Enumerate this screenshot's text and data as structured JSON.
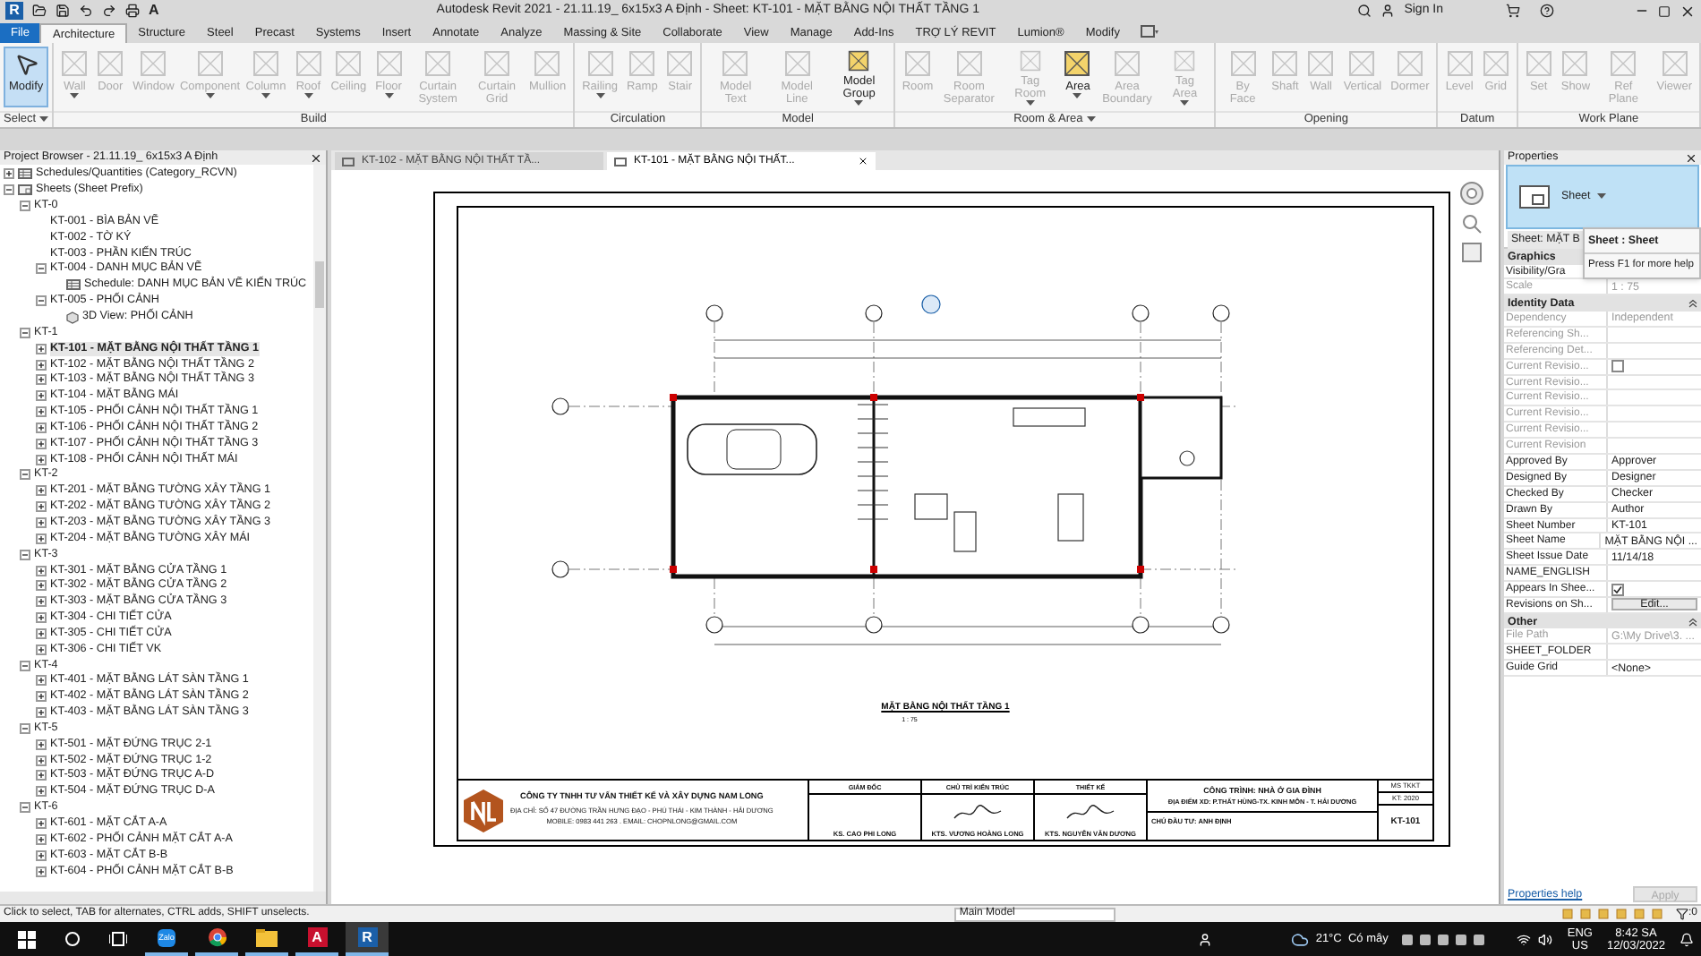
{
  "title_bar": {
    "app_logo": "R",
    "qat_text_tool": "A",
    "title": "Autodesk Revit 2021 - 21.11.19_ 6x15x3 A Định - Sheet: KT-101 - MẶT BẰNG NỘI THẤT TẦNG 1",
    "sign_in": "Sign In"
  },
  "ribbon_tabs": [
    {
      "label": "File",
      "kind": "file",
      "selected": false
    },
    {
      "label": "Architecture",
      "kind": "tab",
      "selected": true
    },
    {
      "label": "Structure",
      "kind": "tab",
      "selected": false
    },
    {
      "label": "Steel",
      "kind": "tab",
      "selected": false
    },
    {
      "label": "Precast",
      "kind": "tab",
      "selected": false
    },
    {
      "label": "Systems",
      "kind": "tab",
      "selected": false
    },
    {
      "label": "Insert",
      "kind": "tab",
      "selected": false
    },
    {
      "label": "Annotate",
      "kind": "tab",
      "selected": false
    },
    {
      "label": "Analyze",
      "kind": "tab",
      "selected": false
    },
    {
      "label": "Massing & Site",
      "kind": "tab",
      "selected": false
    },
    {
      "label": "Collaborate",
      "kind": "tab",
      "selected": false
    },
    {
      "label": "View",
      "kind": "tab",
      "selected": false
    },
    {
      "label": "Manage",
      "kind": "tab",
      "selected": false
    },
    {
      "label": "Add-Ins",
      "kind": "tab",
      "selected": false
    },
    {
      "label": "TRỢ LÝ REVIT",
      "kind": "tab",
      "selected": false
    },
    {
      "label": "Lumion®",
      "kind": "tab",
      "selected": false
    },
    {
      "label": "Modify",
      "kind": "tab",
      "selected": false
    }
  ],
  "ribbon_groups": [
    {
      "label": "Select",
      "dropdown": true,
      "tools": [
        {
          "label": "Modify",
          "disabled": false,
          "selected": true
        }
      ]
    },
    {
      "label": "Build",
      "tools": [
        {
          "label": "Wall",
          "disabled": true,
          "dropdown": true
        },
        {
          "label": "Door",
          "disabled": true
        },
        {
          "label": "Window",
          "disabled": true
        },
        {
          "label": "Component",
          "disabled": true,
          "dropdown": true
        },
        {
          "label": "Column",
          "disabled": true,
          "dropdown": true
        },
        {
          "label": "Roof",
          "disabled": true,
          "dropdown": true
        },
        {
          "label": "Ceiling",
          "disabled": true
        },
        {
          "label": "Floor",
          "disabled": true,
          "dropdown": true
        },
        {
          "label": "Curtain System",
          "disabled": true
        },
        {
          "label": "Curtain Grid",
          "disabled": true
        },
        {
          "label": "Mullion",
          "disabled": true
        }
      ]
    },
    {
      "label": "Circulation",
      "tools": [
        {
          "label": "Railing",
          "disabled": true,
          "dropdown": true
        },
        {
          "label": "Ramp",
          "disabled": true
        },
        {
          "label": "Stair",
          "disabled": true
        }
      ]
    },
    {
      "label": "Model",
      "tools": [
        {
          "label": "Model Text",
          "disabled": true
        },
        {
          "label": "Model Line",
          "disabled": true
        },
        {
          "label": "Model Group",
          "disabled": false,
          "dropdown": true
        }
      ]
    },
    {
      "label": "Room & Area",
      "dropdown": true,
      "tools": [
        {
          "label": "Room",
          "disabled": true
        },
        {
          "label": "Room Separator",
          "disabled": true
        },
        {
          "label": "Tag Room",
          "disabled": true,
          "dropdown": true
        },
        {
          "label": "Area",
          "disabled": false,
          "dropdown": true
        },
        {
          "label": "Area Boundary",
          "disabled": true
        },
        {
          "label": "Tag Area",
          "disabled": true,
          "dropdown": true
        }
      ]
    },
    {
      "label": "Opening",
      "tools": [
        {
          "label": "By Face",
          "disabled": true
        },
        {
          "label": "Shaft",
          "disabled": true
        },
        {
          "label": "Wall",
          "disabled": true
        },
        {
          "label": "Vertical",
          "disabled": true
        },
        {
          "label": "Dormer",
          "disabled": true
        }
      ]
    },
    {
      "label": "Datum",
      "tools": [
        {
          "label": "Level",
          "disabled": true
        },
        {
          "label": "Grid",
          "disabled": true
        }
      ]
    },
    {
      "label": "Work Plane",
      "tools": [
        {
          "label": "Set",
          "disabled": true
        },
        {
          "label": "Show",
          "disabled": true
        },
        {
          "label": "Ref Plane",
          "disabled": true
        },
        {
          "label": "Viewer",
          "disabled": true
        }
      ]
    }
  ],
  "project_browser": {
    "title": "Project Browser - 21.11.19_ 6x15x3 A Định",
    "items": [
      {
        "label": "Schedules/Quantities (Category_RCVN)",
        "kind": "schedules",
        "expanded": false
      },
      {
        "label": "Sheets (Sheet Prefix)",
        "kind": "sheets",
        "expanded": true,
        "children": [
          {
            "label": "KT-0",
            "expanded": true,
            "children": [
              {
                "label": "KT-001 - BÌA BẢN VẼ",
                "selected": false
              },
              {
                "label": "KT-002 - TỜ KÝ",
                "selected": false
              },
              {
                "label": "KT-003 - PHẦN KIẾN TRÚC",
                "selected": false
              },
              {
                "label": "KT-004 - DANH MỤC BẢN VẼ",
                "selected": false,
                "expanded": true,
                "children": [
                  {
                    "label": "Schedule: DANH MỤC BẢN VẼ KIẾN TRÚC",
                    "kind": "schedule"
                  }
                ]
              },
              {
                "label": "KT-005 - PHỐI CẢNH",
                "selected": false,
                "expanded": true,
                "children": [
                  {
                    "label": "3D View: PHỐI CẢNH",
                    "kind": "view3d"
                  }
                ]
              }
            ]
          },
          {
            "label": "KT-1",
            "expanded": true,
            "children": [
              {
                "label": "KT-101 - MẶT BẰNG NỘI THẤT TẦNG 1",
                "selected": true,
                "expanded": false
              },
              {
                "label": "KT-102 - MẶT BẰNG NỘI THẤT TẦNG 2",
                "selected": false,
                "expanded": false
              },
              {
                "label": "KT-103 - MẶT BẰNG NỘI THẤT TẦNG 3",
                "selected": false,
                "expanded": false
              },
              {
                "label": "KT-104 - MẶT BẰNG MÁI",
                "selected": false,
                "expanded": false
              },
              {
                "label": "KT-105 - PHỐI CẢNH NỘI THẤT TẦNG 1",
                "selected": false,
                "expanded": false
              },
              {
                "label": "KT-106 - PHỐI CẢNH NỘI THẤT TẦNG 2",
                "selected": false,
                "expanded": false
              },
              {
                "label": "KT-107 - PHỐI CẢNH NỘI THẤT TẦNG 3",
                "selected": false,
                "expanded": false
              },
              {
                "label": "KT-108 - PHỐI CẢNH NỘI THẤT MÁI",
                "selected": false,
                "expanded": false
              }
            ]
          },
          {
            "label": "KT-2",
            "expanded": true,
            "children": [
              {
                "label": "KT-201 - MẶT BẰNG TƯỜNG XÂY TẦNG 1",
                "selected": false,
                "expanded": false
              },
              {
                "label": "KT-202 - MẶT BẰNG TƯỜNG XÂY TẦNG 2",
                "selected": false,
                "expanded": false
              },
              {
                "label": "KT-203 - MẶT BẰNG TƯỜNG XÂY TẦNG 3",
                "selected": false,
                "expanded": false
              },
              {
                "label": "KT-204 - MẶT BẰNG TƯỜNG XÂY MÁI",
                "selected": false,
                "expanded": false
              }
            ]
          },
          {
            "label": "KT-3",
            "expanded": true,
            "children": [
              {
                "label": "KT-301 - MẶT BẰNG CỬA TẦNG 1",
                "selected": false,
                "expanded": false
              },
              {
                "label": "KT-302 - MẶT BẰNG CỬA TẦNG 2",
                "selected": false,
                "expanded": false
              },
              {
                "label": "KT-303 - MẶT BẰNG CỬA TẦNG 3",
                "selected": false,
                "expanded": false
              },
              {
                "label": "KT-304 - CHI TIẾT CỬA",
                "selected": false,
                "expanded": false
              },
              {
                "label": "KT-305 - CHI TIẾT CỬA",
                "selected": false,
                "expanded": false
              },
              {
                "label": "KT-306 - CHI TIẾT VK",
                "selected": false,
                "expanded": false
              }
            ]
          },
          {
            "label": "KT-4",
            "expanded": true,
            "children": [
              {
                "label": "KT-401 - MẶT BẰNG LÁT SÀN TẦNG 1",
                "selected": false,
                "expanded": false
              },
              {
                "label": "KT-402 - MẶT BẰNG LÁT SÀN TẦNG 2",
                "selected": false,
                "expanded": false
              },
              {
                "label": "KT-403 - MẶT BẰNG LÁT SÀN TẦNG 3",
                "selected": false,
                "expanded": false
              }
            ]
          },
          {
            "label": "KT-5",
            "expanded": true,
            "children": [
              {
                "label": "KT-501 - MẶT ĐỨNG TRỤC 2-1",
                "selected": false,
                "expanded": false
              },
              {
                "label": "KT-502 - MẶT ĐỨNG TRỤC 1-2",
                "selected": false,
                "expanded": false
              },
              {
                "label": "KT-503 - MẶT ĐỨNG TRỤC A-D",
                "selected": false,
                "expanded": false
              },
              {
                "label": "KT-504 - MẶT ĐỨNG TRỤC D-A",
                "selected": false,
                "expanded": false
              }
            ]
          },
          {
            "label": "KT-6",
            "expanded": true,
            "children": [
              {
                "label": "KT-601 - MẶT CẮT A-A",
                "selected": false,
                "expanded": false
              },
              {
                "label": "KT-602 - PHỐI CẢNH MẶT CẮT A-A",
                "selected": false,
                "expanded": false
              },
              {
                "label": "KT-603 - MẶT CẮT B-B",
                "selected": false,
                "expanded": false
              },
              {
                "label": "KT-604 - PHỐI CẢNH MẶT CẮT B-B",
                "selected": false,
                "expanded": false
              }
            ]
          }
        ]
      }
    ]
  },
  "view_tabs": [
    {
      "label": "KT-102 - MẶT BẰNG NỘI THẤT TẦ...",
      "selected": false
    },
    {
      "label": "KT-101 - MẶT BẰNG NỘI THẤT...",
      "selected": true
    }
  ],
  "sheet": {
    "view_title": "MẶT BẰNG NỘI THẤT TẦNG 1",
    "view_scale": "1 : 75",
    "title_block": {
      "company": "CÔNG TY TNHH TƯ VẤN THIẾT KẾ VÀ XÂY DỰNG NAM LONG",
      "address": "ĐỊA CHỈ: SỐ 47 ĐƯỜNG TRẦN HƯNG ĐẠO - PHÚ THÁI - KIM THÀNH - HẢI DƯƠNG",
      "contact": "MOBILE: 0983 441 263 . EMAIL: CHOPNLONG@GMAIL.COM",
      "signers": [
        {
          "role": "GIÁM ĐỐC",
          "name": "KS. CAO PHI LONG",
          "signed": false
        },
        {
          "role": "CHỦ TRÌ KIẾN TRÚC",
          "name": "KTS. VƯƠNG HOÀNG LONG",
          "signed": true
        },
        {
          "role": "THIẾT KẾ",
          "name": "KTS. NGUYỄN VĂN DƯƠNG",
          "signed": true
        }
      ],
      "project": "CÔNG TRÌNH: NHÀ Ở GIA ĐÌNH",
      "location": "ĐỊA ĐIỂM XD: P.THẤT HÙNG-TX. KINH MÔN - T. HẢI DƯƠNG",
      "owner": "CHỦ ĐẦU TƯ: ANH ĐỊNH",
      "code_label": "MS TKKT",
      "code_year": "KT: 2020",
      "sheet_number": "KT-101"
    }
  },
  "properties": {
    "title": "Properties",
    "type_name": "Sheet",
    "instance_label": "Sheet: MẶT B",
    "tooltip": {
      "title": "Sheet : Sheet",
      "hint": "Press F1 for more help"
    },
    "groups": [
      {
        "label": "Graphics",
        "rows": [
          {
            "label": "Visibility/Gra",
            "kind": "text",
            "disabled": false
          },
          {
            "label": "Scale",
            "value": "1 : 75",
            "kind": "text",
            "disabled": true
          }
        ]
      },
      {
        "label": "Identity Data",
        "rows": [
          {
            "label": "Dependency",
            "value": "Independent",
            "kind": "text",
            "disabled": true
          },
          {
            "label": "Referencing Sh...",
            "kind": "text",
            "disabled": true
          },
          {
            "label": "Referencing Det...",
            "kind": "text",
            "disabled": true
          },
          {
            "label": "Current Revisio...",
            "kind": "checkbox",
            "checked": false,
            "disabled": true
          },
          {
            "label": "Current Revisio...",
            "kind": "text",
            "disabled": true
          },
          {
            "label": "Current Revisio...",
            "kind": "text",
            "disabled": true
          },
          {
            "label": "Current Revisio...",
            "kind": "text",
            "disabled": true
          },
          {
            "label": "Current Revisio...",
            "kind": "text",
            "disabled": true
          },
          {
            "label": "Current Revision",
            "kind": "text",
            "disabled": true
          },
          {
            "label": "Approved By",
            "value": "Approver",
            "kind": "text",
            "disabled": false
          },
          {
            "label": "Designed By",
            "value": "Designer",
            "kind": "text",
            "disabled": false
          },
          {
            "label": "Checked By",
            "value": "Checker",
            "kind": "text",
            "disabled": false
          },
          {
            "label": "Drawn By",
            "value": "Author",
            "kind": "text",
            "disabled": false
          },
          {
            "label": "Sheet Number",
            "value": "KT-101",
            "kind": "text",
            "disabled": false
          },
          {
            "label": "Sheet Name",
            "value": "MẶT BẰNG NỘI ...",
            "kind": "text",
            "disabled": false
          },
          {
            "label": "Sheet Issue Date",
            "value": "11/14/18",
            "kind": "text",
            "disabled": false
          },
          {
            "label": "NAME_ENGLISH",
            "kind": "text",
            "disabled": false
          },
          {
            "label": "Appears In Shee...",
            "kind": "checkbox",
            "checked": true,
            "disabled": false
          },
          {
            "label": "Revisions on Sh...",
            "value": "Edit...",
            "kind": "button",
            "disabled": false
          }
        ]
      },
      {
        "label": "Other",
        "rows": [
          {
            "label": "File Path",
            "value": "G:\\My Drive\\3. ...",
            "kind": "text",
            "disabled": true
          },
          {
            "label": "SHEET_FOLDER",
            "kind": "text",
            "disabled": false
          },
          {
            "label": "Guide Grid",
            "value": "<None>",
            "kind": "text",
            "disabled": false
          }
        ]
      }
    ],
    "help_link": "Properties help",
    "apply": {
      "label": "Apply",
      "disabled": true
    }
  },
  "status_bar": {
    "hint": "Click to select, TAB for alternates, CTRL adds, SHIFT unselects.",
    "model": "Main Model",
    "filter_count": ":0"
  },
  "taskbar": {
    "apps": [
      {
        "label": "Zalo",
        "kind": "zalo",
        "selected": false
      },
      {
        "kind": "chrome",
        "selected": false
      },
      {
        "kind": "explorer",
        "selected": false
      },
      {
        "label": "A",
        "kind": "autocad",
        "selected": false
      },
      {
        "label": "R",
        "kind": "revit",
        "selected": true
      }
    ],
    "weather": "21°C  Có mây",
    "language": "ENG",
    "region": "US",
    "time": "8:42 SA",
    "date": "12/03/2022"
  }
}
